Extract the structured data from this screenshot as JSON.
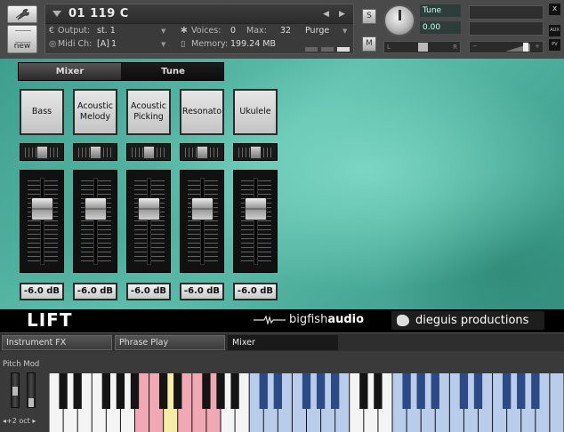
{
  "header": {
    "instrument_name": "01 119 C",
    "output_label": "Output:",
    "output_value": "st. 1",
    "voices_label": "Voices:",
    "voices_value": "0",
    "max_label": "Max:",
    "max_value": "32",
    "purge_label": "Purge",
    "midi_label": "Midi Ch:",
    "midi_port": "[A]",
    "midi_channel": "1",
    "memory_label": "Memory:",
    "memory_value": "199.24 MB",
    "new_label": "new",
    "s_label": "S",
    "m_label": "M",
    "tune_label": "Tune",
    "tune_value": "0.00",
    "pan_left": "L",
    "pan_right": "R",
    "aux_label": "AUX",
    "pv_label": "PV",
    "close_label": "x"
  },
  "mode_tabs": [
    {
      "label": "Mixer",
      "active": true
    },
    {
      "label": "Tune",
      "active": false
    }
  ],
  "channels": [
    {
      "name": "Bass",
      "level": "-6.0 dB"
    },
    {
      "name": "Acoustic Melody",
      "level": "-6.0 dB"
    },
    {
      "name": "Acoustic Picking",
      "level": "-6.0 dB"
    },
    {
      "name": "Resonato",
      "level": "-6.0 dB"
    },
    {
      "name": "Ukulele",
      "level": "-6.0 dB"
    }
  ],
  "branding": {
    "product": "LIFT",
    "vendor_light": "bigfish",
    "vendor_bold": "audio",
    "producer": "dieguis productions"
  },
  "bottom_tabs": [
    {
      "label": "Instrument FX",
      "active": false
    },
    {
      "label": "Phrase Play",
      "active": false
    },
    {
      "label": "Mixer",
      "active": true
    }
  ],
  "keyboard": {
    "pitch_mod_label": "Pitch Mod",
    "octave_label": "◂+2 oct ▸",
    "white_key_count": 36,
    "colors": {
      "highlight_pink": "#f0a8b4",
      "highlight_yellow": "#f6eea8",
      "mapped_blue": "#b9cdea",
      "mapped_black": "#2c4b86",
      "white": "#f4f4f4",
      "black": "#141414"
    },
    "pink_white_keys": [
      6,
      7,
      9,
      10,
      11
    ],
    "yellow_white_keys": [
      8
    ],
    "blue_white_keys": [
      14,
      15,
      16,
      17,
      18,
      19,
      20,
      24,
      25,
      26,
      27,
      28,
      29,
      30,
      31,
      32,
      33,
      34,
      35
    ]
  },
  "accent_colors": {
    "teal_background": "#4aab99",
    "panel_dark": "#3a3a3a"
  }
}
